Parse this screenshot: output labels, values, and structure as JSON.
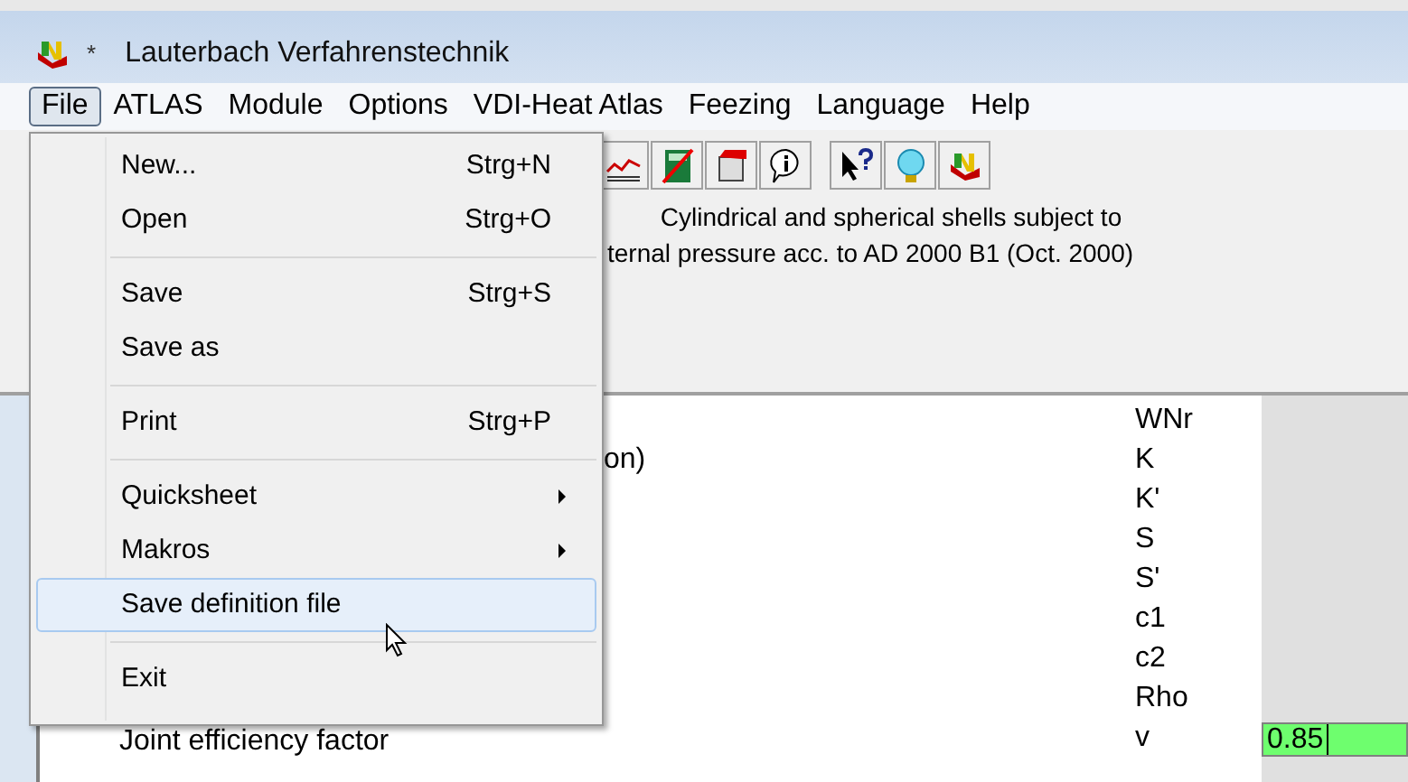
{
  "window": {
    "title": "Lauterbach Verfahrenstechnik",
    "modified_mark": "*"
  },
  "menu_bar": [
    {
      "label": "File",
      "selected": true
    },
    {
      "label": "ATLAS",
      "selected": false
    },
    {
      "label": "Module",
      "selected": false
    },
    {
      "label": "Options",
      "selected": false
    },
    {
      "label": "VDI-Heat Atlas",
      "selected": false
    },
    {
      "label": "Feezing",
      "selected": false
    },
    {
      "label": "Language",
      "selected": false
    },
    {
      "label": "Help",
      "selected": false
    }
  ],
  "file_menu": [
    {
      "kind": "item",
      "label": "New...",
      "shortcut": "Strg+N",
      "selected": false
    },
    {
      "kind": "item",
      "label": "Open",
      "shortcut": "Strg+O",
      "selected": false
    },
    {
      "kind": "separator"
    },
    {
      "kind": "item",
      "label": "Save",
      "shortcut": "Strg+S",
      "selected": false
    },
    {
      "kind": "item",
      "label": "Save as",
      "selected": false
    },
    {
      "kind": "separator"
    },
    {
      "kind": "item",
      "label": "Print",
      "shortcut": "Strg+P",
      "selected": false
    },
    {
      "kind": "separator"
    },
    {
      "kind": "submenu",
      "label": "Quicksheet",
      "selected": false
    },
    {
      "kind": "submenu",
      "label": "Makros",
      "selected": false
    },
    {
      "kind": "item",
      "label": "Save definition file",
      "selected": true
    },
    {
      "kind": "separator"
    },
    {
      "kind": "item",
      "label": "Exit",
      "selected": false
    }
  ],
  "description": [
    "Cylindrical and spherical shells subject to",
    "ternal pressure acc. to AD 2000 B1 (Oct. 2000)"
  ],
  "rows": [
    {
      "symbol": "WNr"
    },
    {
      "label": "on)",
      "symbol": "K"
    },
    {
      "symbol": "K'"
    },
    {
      "symbol": "S"
    },
    {
      "symbol": "S'"
    },
    {
      "symbol": "c1"
    },
    {
      "symbol": "c2"
    },
    {
      "symbol": "Rho"
    },
    {
      "label": "Joint efficiency factor",
      "symbol": "v",
      "value": "0.85"
    }
  ]
}
